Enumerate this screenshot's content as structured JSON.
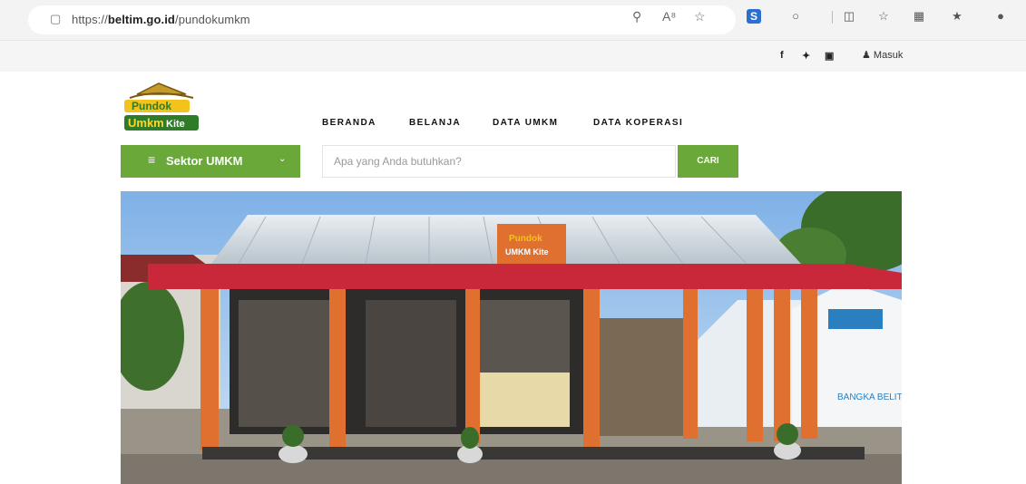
{
  "browser": {
    "url_prefix": "https://",
    "url_domain": "beltim.go.id",
    "url_path": "/pundokumkm",
    "icons": [
      "lock-icon",
      "zoom-icon",
      "read-aloud-icon",
      "favorite-star-icon",
      "extension-s-icon",
      "extension-puzzle-icon",
      "split-screen-icon",
      "favorites-icon",
      "collections-icon",
      "extension-check-icon",
      "profile-icon"
    ]
  },
  "topbar": {
    "social": [
      "f",
      "✦",
      "▣"
    ],
    "login_label": "Masuk"
  },
  "logo": {
    "line1": "Pundok",
    "line2a": "Umkm",
    "line2b": "Kite"
  },
  "nav": {
    "items": [
      "BERANDA",
      "BELANJA",
      "DATA UMKM",
      "DATA KOPERASI"
    ]
  },
  "sektor": {
    "label": "Sektor UMKM"
  },
  "search": {
    "placeholder": "Apa yang Anda butuhkan?",
    "button_label": "CARI"
  },
  "hero": {
    "sign_line1": "Pundok",
    "sign_line2": "UMKM Kite",
    "tent_text": "BANGKA BELITUNG"
  },
  "colors": {
    "accent_green": "#6aa83a",
    "roof_red": "#c8283a",
    "pillar_orange": "#e07030"
  }
}
